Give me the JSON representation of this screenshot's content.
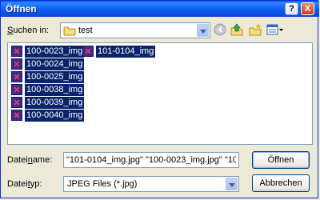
{
  "window": {
    "title": "Öffnen",
    "help_label": "?",
    "close_label": "X"
  },
  "lookin": {
    "label_prefix": "S",
    "label_rest": "uchen in:",
    "value": "test"
  },
  "toolbar": {
    "icons": [
      "folder-icon",
      "back-icon",
      "up-folder-icon",
      "new-folder-icon",
      "views-icon"
    ]
  },
  "files": {
    "col1": [
      "100-0023_img",
      "100-0024_img",
      "100-0025_img",
      "100-0038_img",
      "100-0039_img",
      "100-0040_img"
    ],
    "col2": [
      "101-0104_img"
    ]
  },
  "filename": {
    "label_pre": "Datei",
    "label_u": "n",
    "label_post": "ame:",
    "value": "\"101-0104_img.jpg\" \"100-0023_img.jpg\" \"100-0"
  },
  "filetype": {
    "label_pre": "Datei",
    "label_u": "t",
    "label_post": "yp:",
    "value": "JPEG Files (*.jpg)"
  },
  "buttons": {
    "open": "Öffnen",
    "cancel": "Abbrechen"
  },
  "colors": {
    "selection": "#0a246a",
    "titlebar": "#0a57ea"
  }
}
